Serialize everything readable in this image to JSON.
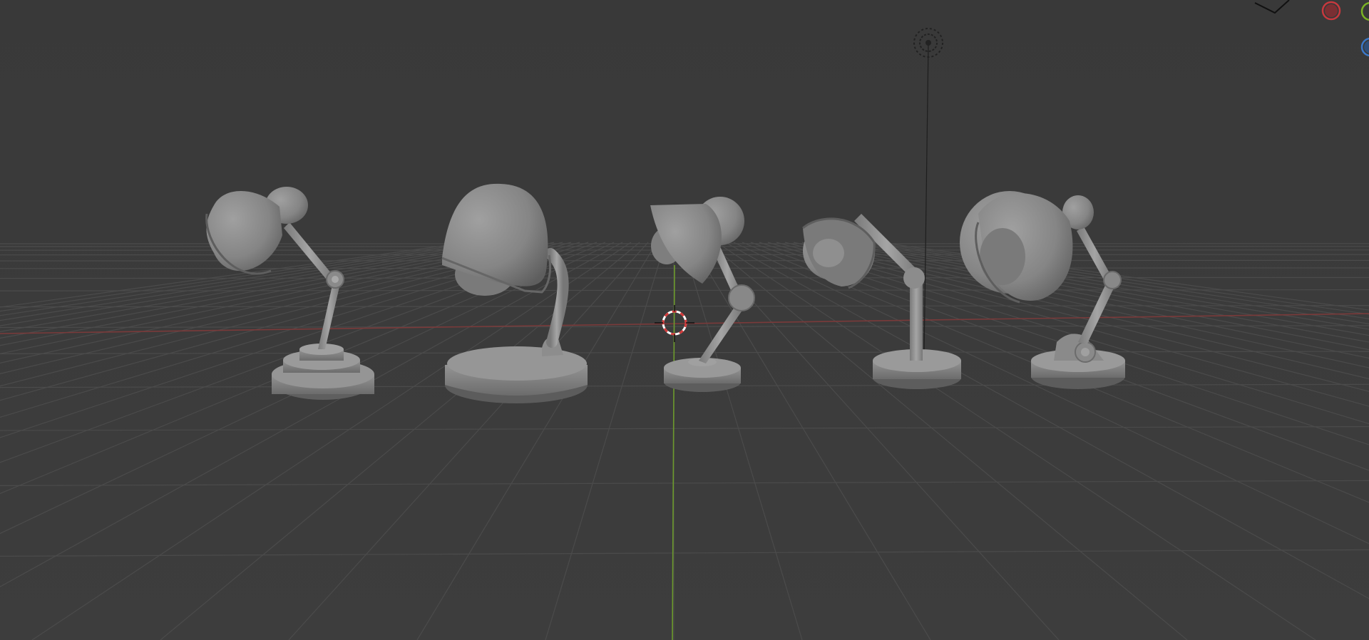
{
  "viewport": {
    "mode": "solid",
    "background_color": "#3a3a3a",
    "grid_color": "#4a4a4a",
    "x_axis_color": "#7a3a3a",
    "y_axis_color": "#6c9a2c",
    "object_color": "#8a8a8a",
    "objects": [
      {
        "name": "desk-lamp-1",
        "type": "mesh"
      },
      {
        "name": "desk-lamp-2",
        "type": "mesh"
      },
      {
        "name": "desk-lamp-3",
        "type": "mesh"
      },
      {
        "name": "desk-lamp-4",
        "type": "mesh"
      },
      {
        "name": "desk-lamp-5",
        "type": "mesh"
      }
    ],
    "light": {
      "icon": "point-light-icon"
    },
    "cursor": {
      "icon": "3d-cursor-icon"
    }
  },
  "nav_gizmo": {
    "x_color": "#c8383d",
    "y_color": "#7bb324",
    "z_color": "#3c78c8"
  }
}
